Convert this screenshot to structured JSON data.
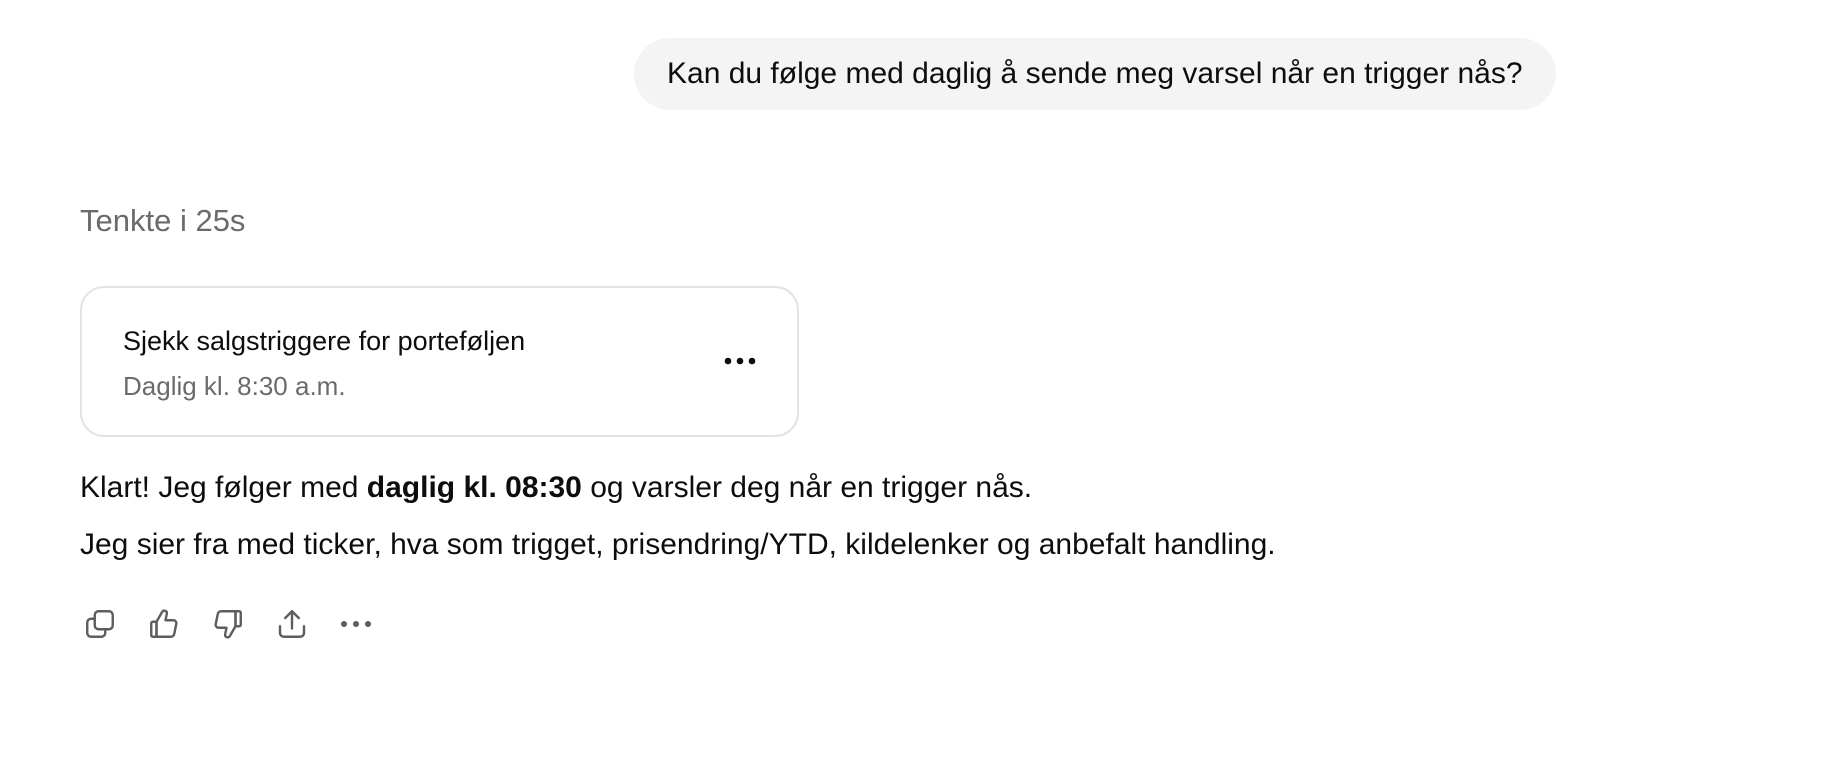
{
  "user_message": {
    "text": "Kan du følge med daglig å sende meg varsel når en trigger nås?"
  },
  "thinking": {
    "label": "Tenkte i 25s"
  },
  "task_card": {
    "title": "Sjekk salgstriggere for porteføljen",
    "schedule": "Daglig kl. 8:30 a.m.",
    "more_icon": "more-horizontal-icon"
  },
  "answer": {
    "line1_prefix": "Klart! Jeg følger med ",
    "line1_bold": "daglig kl. 08:30",
    "line1_suffix": " og varsler deg når en trigger nås.",
    "line2": "Jeg sier fra med ticker, hva som trigget, prisendring/YTD, kildelenker og anbefalt handling."
  },
  "actions": [
    {
      "name": "copy",
      "icon": "copy-icon"
    },
    {
      "name": "thumbs-up",
      "icon": "thumbs-up-icon"
    },
    {
      "name": "thumbs-down",
      "icon": "thumbs-down-icon"
    },
    {
      "name": "share",
      "icon": "share-icon"
    },
    {
      "name": "more",
      "icon": "more-horizontal-icon"
    }
  ],
  "colors": {
    "bubble_bg": "#f4f4f4",
    "text_primary": "#0d0d0d",
    "text_secondary": "#6b6b6b",
    "card_border": "#e3e3e3",
    "icon": "#5d5d5d"
  }
}
